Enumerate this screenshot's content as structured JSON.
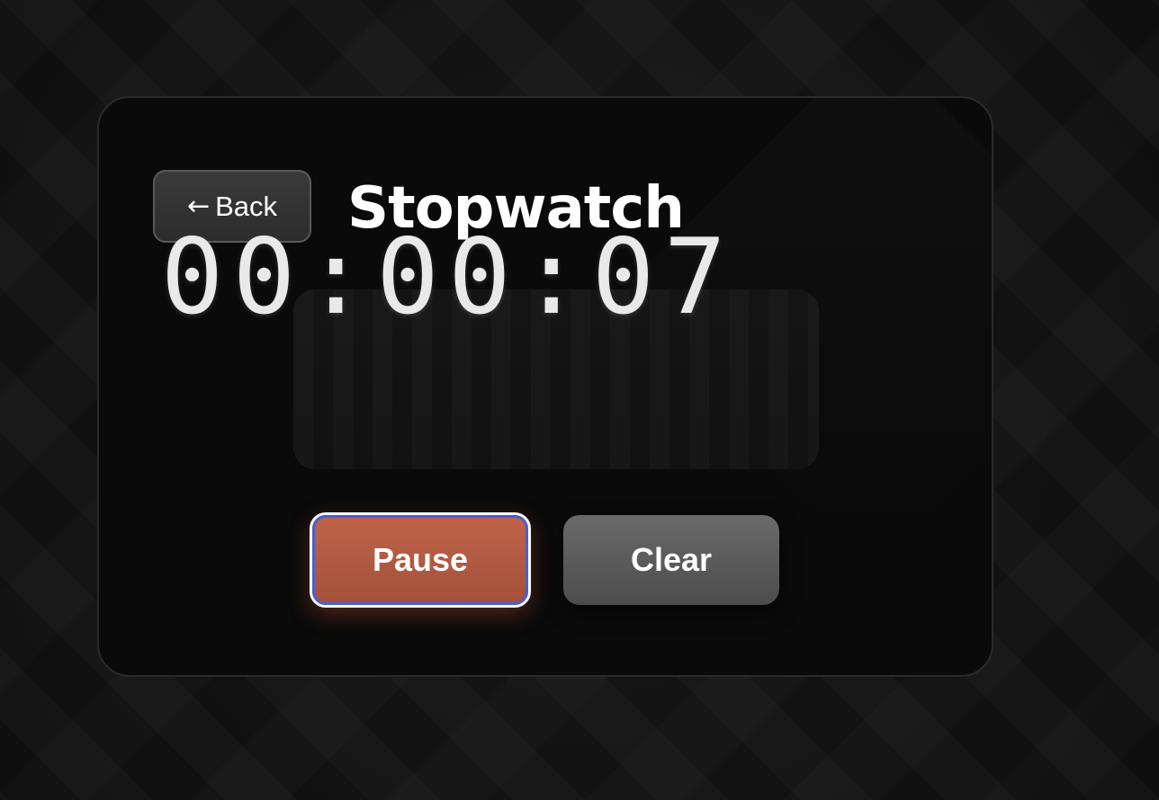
{
  "header": {
    "back_label": "Back",
    "back_arrow": "←",
    "title": "Stopwatch"
  },
  "stopwatch": {
    "time": "00:00:07"
  },
  "controls": {
    "pause_label": "Pause",
    "clear_label": "Clear"
  },
  "colors": {
    "pause_accent": "#b35a42",
    "focus_ring": "#4a5fd0",
    "clear_bg": "#5a5a5a",
    "card_bg": "#0a0a0a"
  },
  "icons": {
    "back": "arrow-left-icon"
  }
}
